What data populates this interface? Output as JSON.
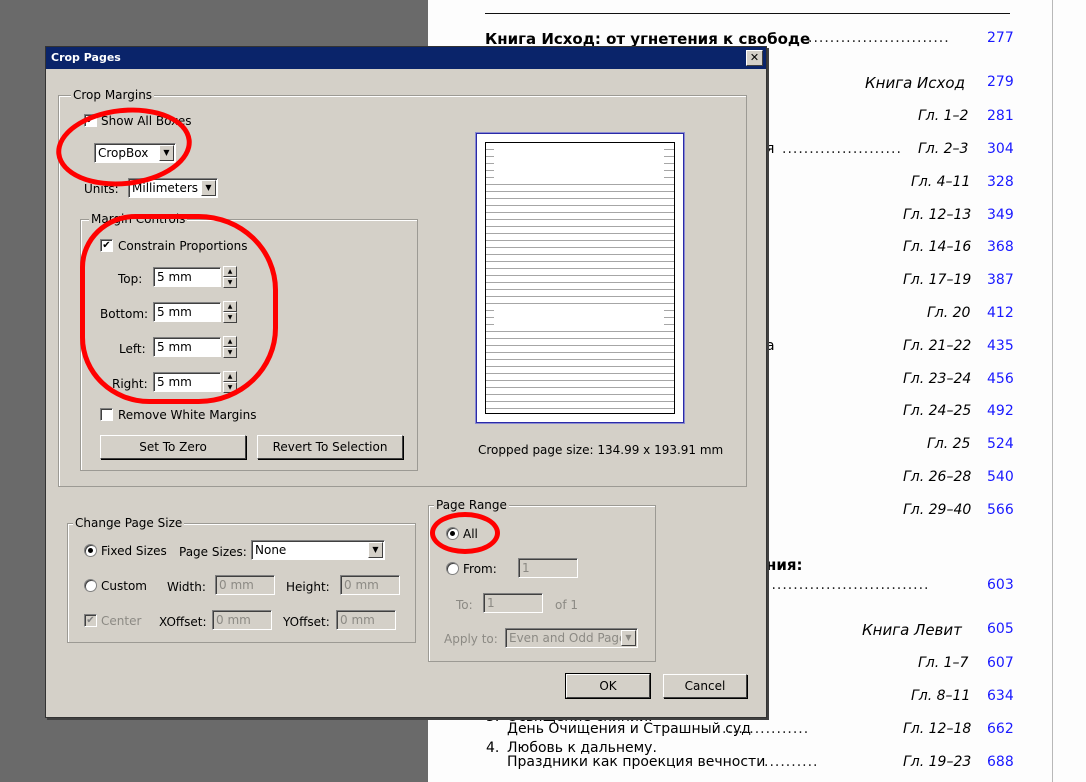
{
  "document": {
    "lines": [
      {
        "prefix": "",
        "text": "Книга Исход: от угнетения к свободе",
        "dots": "..........................",
        "page": "277",
        "style": "heading"
      },
      {
        "prefix": "",
        "text": "",
        "dots": "",
        "label": "Книга Исход",
        "page": "279",
        "style": "section"
      },
      {
        "prefix": "",
        "text": "",
        "dots": "",
        "label": "Гл. 1–2",
        "page": "281"
      },
      {
        "prefix": "",
        "text": "я",
        "dots": "......................",
        "label": "Гл. 2–3",
        "page": "304"
      },
      {
        "prefix": "",
        "text": "",
        "dots": "",
        "label": "Гл. 4–11",
        "page": "328"
      },
      {
        "prefix": "",
        "text": "",
        "dots": "",
        "label": "Гл. 12–13",
        "page": "349"
      },
      {
        "prefix": "",
        "text": "",
        "dots": "",
        "label": "Гл. 14–16",
        "page": "368"
      },
      {
        "prefix": "",
        "text": "",
        "dots": "",
        "label": "Гл. 17–19",
        "page": "387"
      },
      {
        "prefix": "",
        "text": "",
        "dots": "",
        "label": "Гл. 20",
        "page": "412"
      },
      {
        "prefix": "",
        "text": "а",
        "dots": "",
        "label": "Гл. 21–22",
        "page": "435"
      },
      {
        "prefix": "",
        "text": "",
        "dots": "",
        "label": "Гл. 23–24",
        "page": "456"
      },
      {
        "prefix": "",
        "text": "",
        "dots": "",
        "label": "Гл. 24–25",
        "page": "492"
      },
      {
        "prefix": "",
        "text": "",
        "dots": "",
        "label": "Гл. 25",
        "page": "524"
      },
      {
        "prefix": "",
        "text": "",
        "dots": "",
        "label": "Гл. 26–28",
        "page": "540"
      },
      {
        "prefix": "",
        "text": "",
        "dots": "",
        "label": "Гл. 29–40",
        "page": "566"
      },
      {
        "prefix": "",
        "text": "ния:",
        "dots": "",
        "label": "",
        "page": "",
        "style": "heading"
      },
      {
        "prefix": "",
        "text": "",
        "dots": "..............................",
        "label": "",
        "page": "603"
      },
      {
        "prefix": "",
        "text": "",
        "dots": "",
        "label": "Книга Левит",
        "page": "605",
        "style": "section"
      },
      {
        "prefix": "",
        "text": "",
        "dots": "",
        "label": "Гл. 1–7",
        "page": "607"
      },
      {
        "prefix": "",
        "text": "",
        "dots": "",
        "label": "Гл. 8–11",
        "page": "634"
      },
      {
        "prefix": "3.",
        "text": "Освящение скинии.",
        "dots": "",
        "label": "",
        "page": ""
      },
      {
        "prefix": "",
        "text": "День Очищения и Страшный суд",
        "dots": "................",
        "label": "Гл. 12–18",
        "page": "662"
      },
      {
        "prefix": "4.",
        "text": "Любовь к дальнему.",
        "dots": "",
        "label": "",
        "page": ""
      },
      {
        "prefix": "",
        "text": "Праздники как проекция вечности",
        "dots": "..........",
        "label": "Гл. 19–23",
        "page": "688"
      }
    ]
  },
  "dialog": {
    "title": "Crop Pages",
    "close_glyph": "✕",
    "crop_margins": {
      "legend": "Crop Margins",
      "show_all_boxes_label": "Show All Boxes",
      "show_all_boxes_checked": true,
      "box_select": "CropBox",
      "units_label": "Units:",
      "units_select": "Millimeters",
      "margin_controls": {
        "legend": "Margin Controls",
        "constrain_label": "Constrain Proportions",
        "constrain_checked": true,
        "top_label": "Top:",
        "top_value": "5 mm",
        "bottom_label": "Bottom:",
        "bottom_value": "5 mm",
        "left_label": "Left:",
        "left_value": "5 mm",
        "right_label": "Right:",
        "right_value": "5 mm"
      },
      "remove_white_label": "Remove White Margins",
      "remove_white_checked": false,
      "set_to_zero_label": "Set To Zero",
      "revert_label": "Revert To Selection",
      "cropped_size_text": "Cropped page size: 134.99 x 193.91 mm"
    },
    "change_page_size": {
      "legend": "Change Page Size",
      "fixed_sizes_label": "Fixed Sizes",
      "page_sizes_label": "Page Sizes:",
      "page_sizes_value": "None",
      "custom_label": "Custom",
      "width_label": "Width:",
      "width_value": "0 mm",
      "height_label": "Height:",
      "height_value": "0 mm",
      "center_label": "Center",
      "xoffset_label": "XOffset:",
      "xoffset_value": "0 mm",
      "yoffset_label": "YOffset:",
      "yoffset_value": "0 mm"
    },
    "page_range": {
      "legend": "Page Range",
      "all_label": "All",
      "from_label": "From:",
      "from_value": "1",
      "to_label": "To:",
      "to_value": "1",
      "of_label": "of 1",
      "apply_to_label": "Apply to:",
      "apply_to_value": "Even and Odd Pages"
    },
    "ok_label": "OK",
    "cancel_label": "Cancel"
  },
  "colors": {
    "dialog_bg": "#d4d0c8",
    "title_bar": "#0a246a",
    "link_numbers": "#1a1aff",
    "annotation": "#ff0000"
  }
}
